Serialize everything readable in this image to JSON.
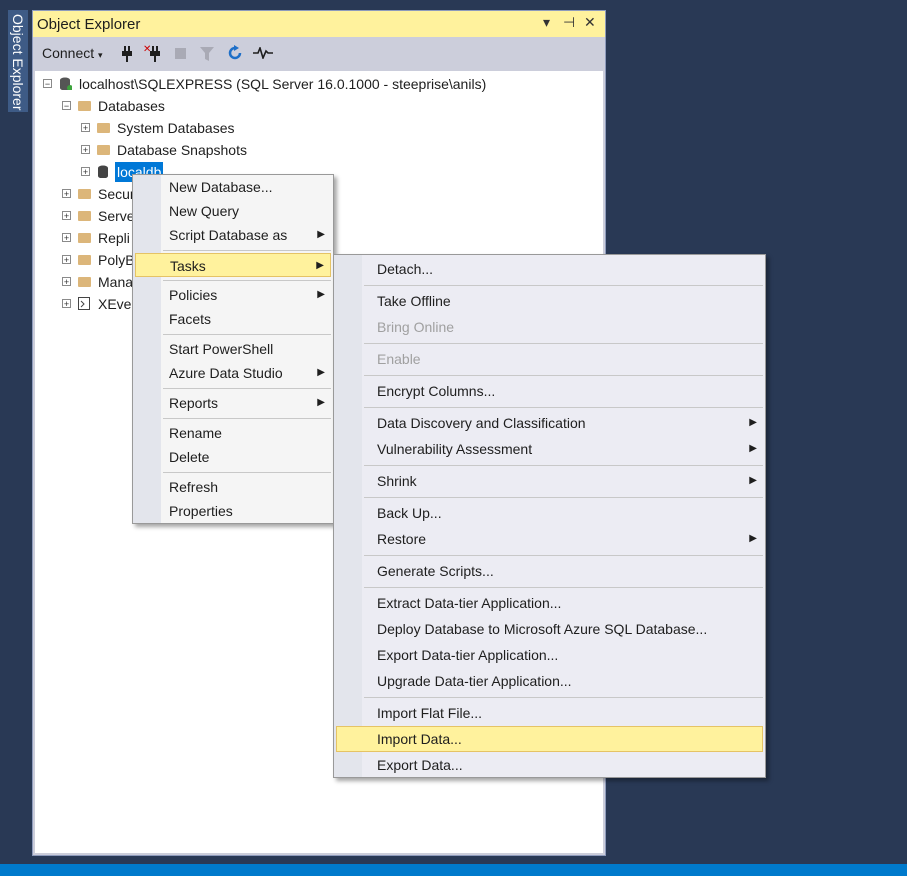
{
  "side_tab": {
    "label": "Object Explorer"
  },
  "panel": {
    "title": "Object Explorer",
    "controls": {
      "dropdown": "▾",
      "pin": "⊣",
      "close": "✕"
    },
    "toolbar": {
      "connect_label": "Connect"
    }
  },
  "tree": {
    "server": "localhost\\SQLEXPRESS (SQL Server 16.0.1000 - steeprise\\anils)",
    "databases": "Databases",
    "system_databases": "System Databases",
    "database_snapshots": "Database Snapshots",
    "localdb": "localdb",
    "security": "Secur",
    "server_objects": "Serve",
    "replication": "Repli",
    "polybase": "PolyB",
    "management": "Mana",
    "xevent": "XEven"
  },
  "context_menu": {
    "items": [
      "New Database...",
      "New Query",
      "Script Database as",
      "Tasks",
      "Policies",
      "Facets",
      "Start PowerShell",
      "Azure Data Studio",
      "Reports",
      "Rename",
      "Delete",
      "Refresh",
      "Properties"
    ]
  },
  "tasks_menu": {
    "items": [
      "Detach...",
      "Take Offline",
      "Bring Online",
      "Enable",
      "Encrypt Columns...",
      "Data Discovery and Classification",
      "Vulnerability Assessment",
      "Shrink",
      "Back Up...",
      "Restore",
      "Generate Scripts...",
      "Extract Data-tier Application...",
      "Deploy Database to Microsoft Azure SQL Database...",
      "Export Data-tier Application...",
      "Upgrade Data-tier Application...",
      "Import Flat File...",
      "Import Data...",
      "Export Data..."
    ]
  },
  "colors": {
    "background": "#293955",
    "highlight": "#fff29d",
    "selection": "#0078d7",
    "statusbar": "#007acc"
  }
}
